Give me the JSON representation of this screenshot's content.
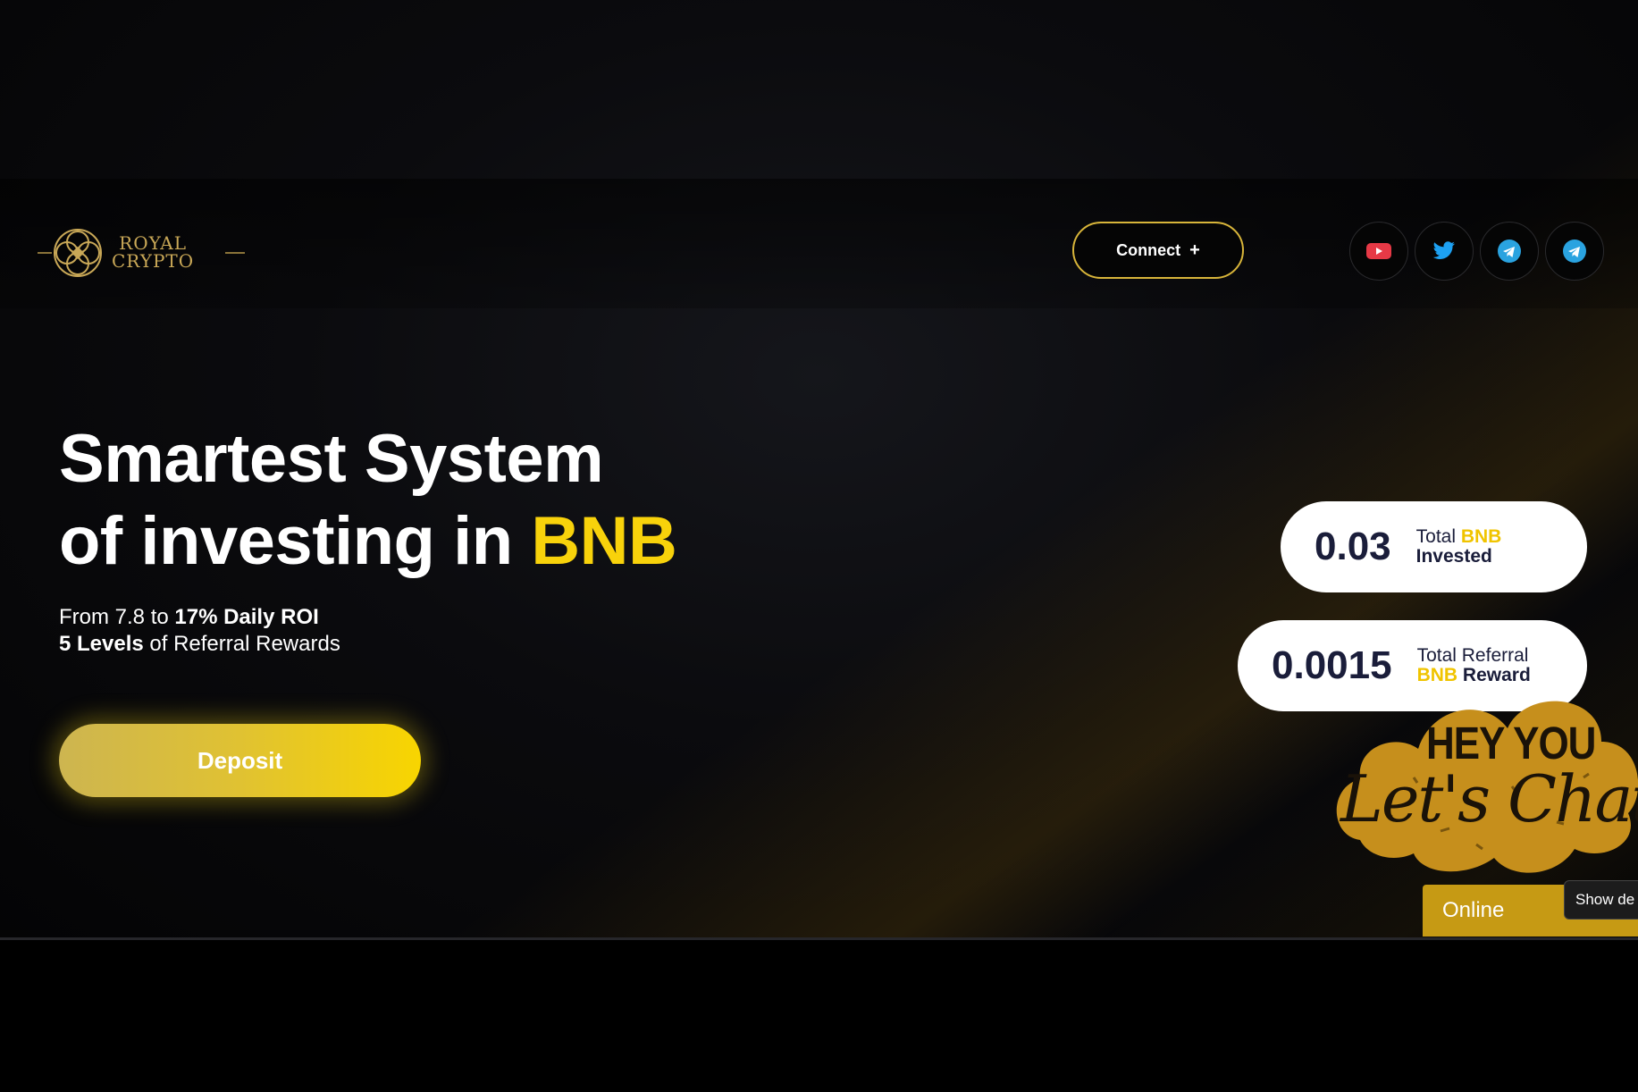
{
  "header": {
    "logo": {
      "line1": "ROYAL",
      "line2": "CRYPTO"
    },
    "connect": {
      "label": "Connect",
      "plus": "+"
    },
    "socials": [
      {
        "icon": "youtube-icon",
        "color": "#e63946"
      },
      {
        "icon": "twitter-icon",
        "color": "#1da1f2"
      },
      {
        "icon": "telegram-icon",
        "color": "#2aa3e0"
      },
      {
        "icon": "telegram-icon",
        "color": "#2aa3e0"
      }
    ]
  },
  "hero": {
    "headline_line1": "Smartest System",
    "headline_line2_prefix": "of investing in ",
    "headline_line2_accent": "BNB",
    "roi_prefix": "From 7.8 to ",
    "roi_bold": "17% Daily ROI",
    "referral_bold": "5 Levels",
    "referral_suffix": " of Referral Rewards",
    "deposit_label": "Deposit"
  },
  "stats": {
    "invested": {
      "value": "0.03",
      "label_plain": "Total",
      "label_yellow": "BNB",
      "label_bold": "Invested"
    },
    "referral": {
      "value": "0.0015",
      "label_plain": "Total Referral",
      "label_yellow": "BNB",
      "label_bold": "Reward"
    }
  },
  "chat": {
    "heading": "HEY YOU",
    "script": "Let's Chat",
    "status": "Online",
    "tooltip": "Show de"
  },
  "colors": {
    "accent": "#f8d20b",
    "gold": "#c69a14",
    "border_gold": "#d8b53a"
  }
}
